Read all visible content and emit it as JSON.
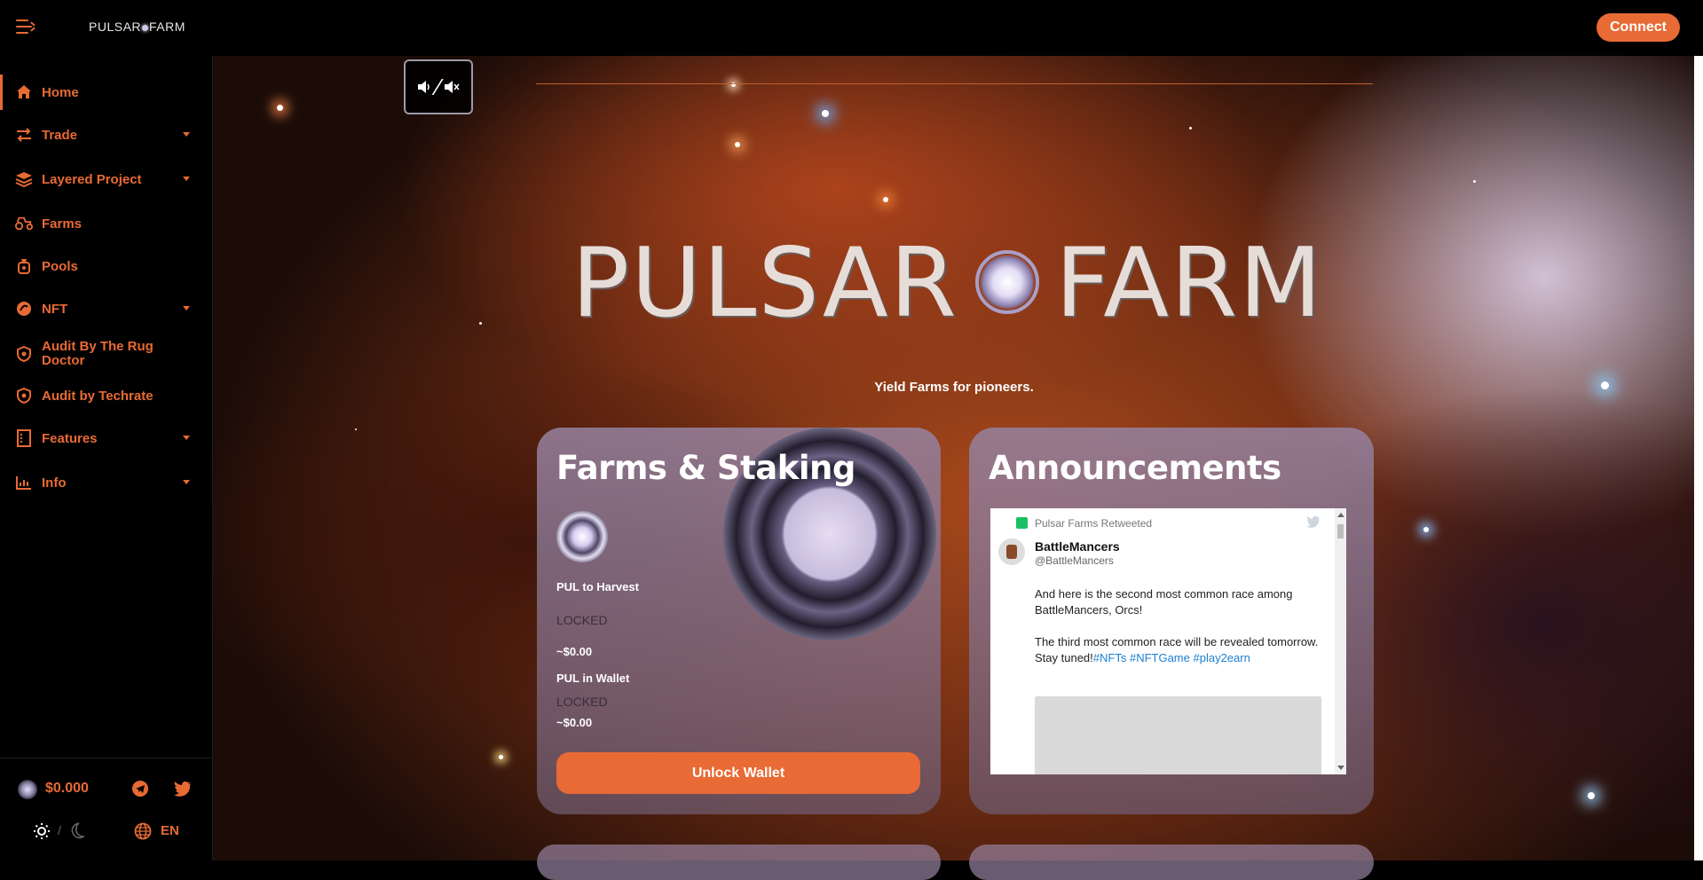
{
  "topbar": {
    "brand_left": "PULSAR",
    "brand_right": "FARM",
    "connect_label": "Connect"
  },
  "sidebar": {
    "items": [
      {
        "label": "Home",
        "icon": "home-icon",
        "has_caret": false,
        "active": true
      },
      {
        "label": "Trade",
        "icon": "arrows-icon",
        "has_caret": true
      },
      {
        "label": "Layered Project",
        "icon": "layers-icon",
        "has_caret": true
      },
      {
        "label": "Farms",
        "icon": "tractor-icon",
        "has_caret": false
      },
      {
        "label": "Pools",
        "icon": "pool-bag-icon",
        "has_caret": false
      },
      {
        "label": "NFT",
        "icon": "nft-icon",
        "has_caret": true
      },
      {
        "label": "Audit By The Rug Doctor",
        "icon": "shield-icon",
        "has_caret": false
      },
      {
        "label": "Audit by Techrate",
        "icon": "shield-icon",
        "has_caret": false
      },
      {
        "label": "Features",
        "icon": "features-icon",
        "has_caret": true
      },
      {
        "label": "Info",
        "icon": "chart-icon",
        "has_caret": true
      }
    ],
    "price": "$0.000",
    "theme_separator": "/",
    "language": "EN"
  },
  "hero": {
    "logo_left": "PULSAR",
    "logo_right": "FARM",
    "tagline": "Yield Farms for pioneers."
  },
  "farms_card": {
    "title": "Farms & Staking",
    "harvest_label": "PUL to Harvest",
    "harvest_status": "LOCKED",
    "harvest_value": "~$0.00",
    "wallet_label": "PUL in Wallet",
    "wallet_status": "LOCKED",
    "wallet_value": "~$0.00",
    "unlock_label": "Unlock Wallet"
  },
  "announcements_card": {
    "title": "Announcements",
    "retweet_text": "Pulsar Farms Retweeted",
    "tweet_name": "BattleMancers",
    "tweet_handle": "@BattleMancers",
    "tweet_text_1": "And here is the second most common race among BattleMancers, Orcs!",
    "tweet_text_2": "The third most common race will be revealed tomorrow. Stay tuned!",
    "hashtags": [
      "#NFTs",
      "#NFTGame",
      "#play2earn"
    ]
  },
  "colors": {
    "accent": "#e86a34",
    "background": "#000000",
    "card": "#9682a0"
  }
}
